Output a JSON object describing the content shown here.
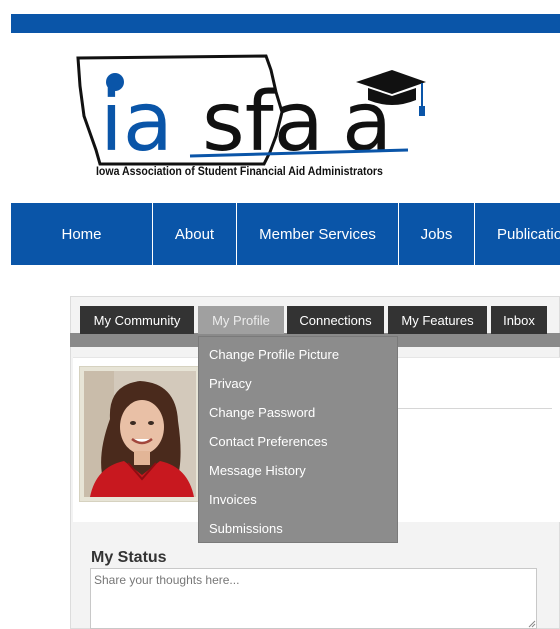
{
  "logo": {
    "wordmark_part1": "ia",
    "wordmark_part2": "sfa",
    "wordmark_part3": "a",
    "tagline": "Iowa Association of Student Financial Aid Administrators"
  },
  "nav": {
    "items": [
      {
        "label": "Home"
      },
      {
        "label": "About"
      },
      {
        "label": "Member Services"
      },
      {
        "label": "Jobs"
      },
      {
        "label": "Publicatio"
      }
    ]
  },
  "tabs": [
    {
      "label": "My Community"
    },
    {
      "label": "My Profile",
      "active": true
    },
    {
      "label": "Connections"
    },
    {
      "label": "My Features"
    },
    {
      "label": "Inbox"
    }
  ],
  "profile_menu": {
    "items": [
      {
        "label": "Change Profile Picture"
      },
      {
        "label": "Privacy"
      },
      {
        "label": "Change Password"
      },
      {
        "label": "Contact Preferences"
      },
      {
        "label": "Message History"
      },
      {
        "label": "Invoices"
      },
      {
        "label": "Submissions"
      }
    ]
  },
  "status": {
    "title": "My Status",
    "placeholder": "Share your thoughts here..."
  },
  "colors": {
    "brand_blue": "#0a55a8",
    "tab_dark": "#333333",
    "tab_active": "#a0a0a0",
    "dropdown_bg": "#8c8c8c"
  }
}
